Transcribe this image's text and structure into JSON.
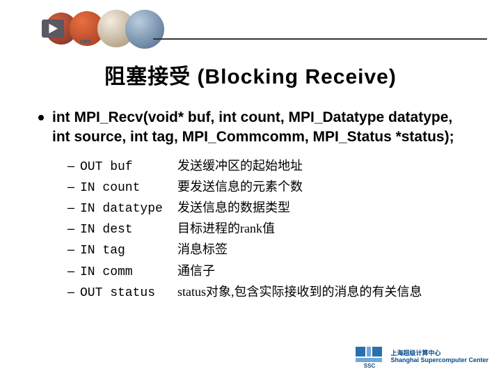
{
  "topstrip": {
    "tiny_text": "HMS"
  },
  "title": "阻塞接受 (Blocking Receive)",
  "signature": "int MPI_Recv(void* buf, int count, MPI_Datatype datatype, int source, int tag, MPI_Commcomm, MPI_Status *status);",
  "params": [
    {
      "name": "OUT buf",
      "desc": "发送缓冲区的起始地址"
    },
    {
      "name": "IN count",
      "desc": "要发送信息的元素个数"
    },
    {
      "name": "IN datatype",
      "desc": "发送信息的数据类型"
    },
    {
      "name": "IN dest",
      "desc": "目标进程的rank值"
    },
    {
      "name": "IN tag",
      "desc": "消息标签"
    },
    {
      "name": "IN comm",
      "desc": "通信子"
    },
    {
      "name": "OUT status",
      "desc": "status对象,包含实际接收到的消息的有关信息"
    }
  ],
  "footer": {
    "org_cn": "上海超级计算中心",
    "org_en": "Shanghai Supercomputer Center"
  }
}
